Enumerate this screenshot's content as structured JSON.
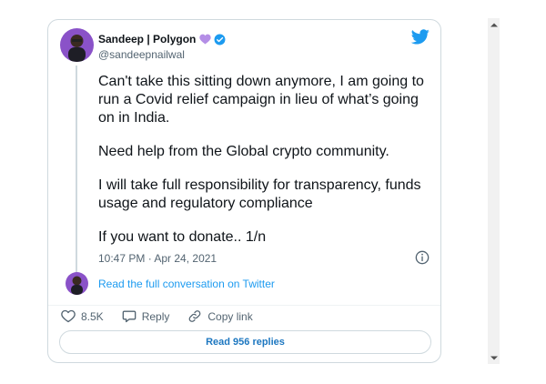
{
  "tweet": {
    "author_name": "Sandeep | Polygon",
    "handle": "@sandeepnailwal",
    "paragraphs": [
      "Can't take this sitting down anymore, I am going to\nrun a Covid relief campaign in lieu of what’s going\non in India.",
      "Need help from the Global crypto community.",
      "I will take full responsibility for transparency, funds\nusage and regulatory compliance",
      "If you want to donate.. 1/n"
    ],
    "timestamp": "10:47 PM · Apr 24, 2021",
    "read_full_label": "Read the full conversation on Twitter",
    "likes": "8.5K",
    "reply_label": "Reply",
    "copy_link_label": "Copy link",
    "read_replies_label": "Read 956 replies"
  },
  "icons": {
    "heart_emoji": "purple-heart-icon",
    "verified": "verified-badge-icon",
    "brand": "twitter-bird-icon",
    "info": "info-icon",
    "like": "heart-outline-icon",
    "reply": "speech-bubble-icon",
    "copy": "link-icon"
  },
  "colors": {
    "brand_blue": "#1d9bf0",
    "purple_heart": "#b48ee6",
    "text": "#0f1419",
    "muted": "#536471",
    "border": "#cfd9de"
  }
}
